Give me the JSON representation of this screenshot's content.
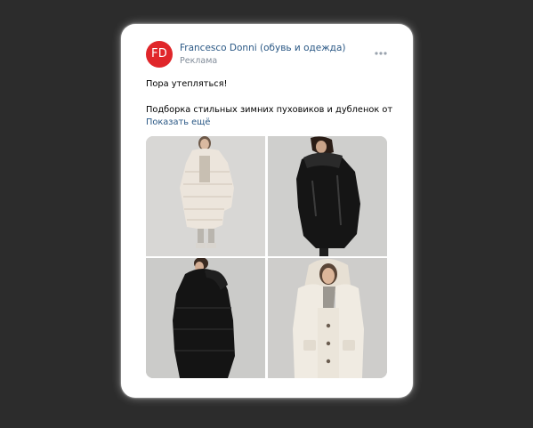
{
  "post": {
    "avatar_initials": "FD",
    "avatar_color": "#e0262a",
    "author": "Francesco Donni (обувь и одежда)",
    "subtitle": "Реклама",
    "more_icon": "more-horizontal-icon",
    "text_line1": "Пора утепляться!",
    "text_line2": "Подборка стильных зимних пуховиков и дубленок от",
    "show_more": "Показать ещё",
    "link_color": "#2a5885"
  },
  "photos": [
    {
      "subject": "woman in long light beige puffer coat"
    },
    {
      "subject": "woman in black leather shearling jacket, side view"
    },
    {
      "subject": "woman in black hooded puffer jacket, side view"
    },
    {
      "subject": "woman in cream faux-fur hooded coat"
    }
  ]
}
